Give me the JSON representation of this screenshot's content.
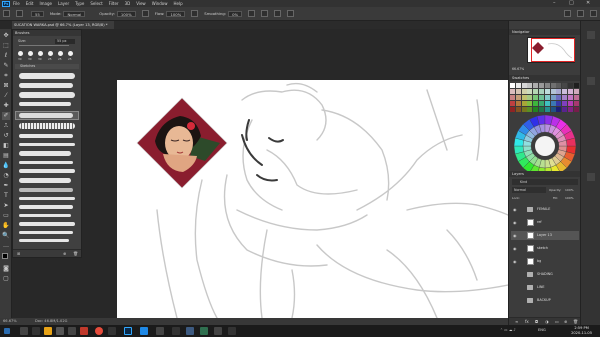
{
  "menubar": {
    "logo": "Ps",
    "items": [
      "File",
      "Edit",
      "Image",
      "Layer",
      "Type",
      "Select",
      "Filter",
      "3D",
      "View",
      "Window",
      "Help"
    ],
    "minimize_icon": "minimize-icon",
    "maximize_icon": "maximize-icon",
    "close_icon": "close-icon"
  },
  "options": {
    "size_value": "55",
    "mode_label": "Mode:",
    "mode_value": "Normal",
    "opacity_label": "Opacity:",
    "opacity_value": "100%",
    "flow_label": "Flow:",
    "flow_value": "100%",
    "smoothing_label": "Smoothing:",
    "smoothing_value": "0%"
  },
  "document": {
    "tab_title": "SUCATION WARKA.psd @ 66.7% (Layer 13, RGB/8) *",
    "zoom": "66.67%",
    "doc_size": "Doc: 46.8M/1.02G"
  },
  "brushes_panel": {
    "title": "Brushes",
    "size_label": "Size:",
    "size_value": "55 px",
    "preset_sizes": [
      "30",
      "30",
      "30",
      "25",
      "25",
      "25"
    ],
    "group_label": "Sketches"
  },
  "navigator_panel": {
    "title": "Navigator",
    "zoom": "66.67%"
  },
  "swatches_panel": {
    "title": "Swatches"
  },
  "layers_panel": {
    "title": "Layers",
    "filter_label": "Kind",
    "blend_mode": "Normal",
    "opacity_label": "Opacity:",
    "opacity_value": "100%",
    "fill_label": "Fill:",
    "fill_value": "100%",
    "lock_label": "Lock:",
    "layers": [
      {
        "name": "FEMALE",
        "type": "group",
        "visible": true,
        "selected": false
      },
      {
        "name": "ref",
        "type": "layer",
        "visible": true,
        "selected": false
      },
      {
        "name": "Layer 13",
        "type": "layer",
        "visible": true,
        "selected": true
      },
      {
        "name": "sketch",
        "type": "layer",
        "visible": true,
        "selected": false
      },
      {
        "name": "bg",
        "type": "layer",
        "visible": true,
        "selected": false
      },
      {
        "name": "SHADING",
        "type": "group",
        "visible": false,
        "selected": false
      },
      {
        "name": "LINE",
        "type": "group",
        "visible": false,
        "selected": false
      },
      {
        "name": "BACKUP",
        "type": "group",
        "visible": false,
        "selected": false
      }
    ]
  },
  "taskbar": {
    "time": "2:59 PM",
    "date": "2020-11-05",
    "language": "ENG"
  },
  "colors": {
    "accent": "#31a8ff",
    "reference_bg": "#8a1d2e",
    "reference_bg2": "#2d4a2a",
    "nav_frame": "#e02424"
  }
}
